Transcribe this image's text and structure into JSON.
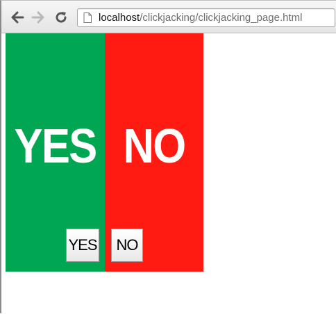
{
  "browser": {
    "url_host": "localhost",
    "url_path": "/clickjacking/clickjacking_page.html"
  },
  "colors": {
    "yes_panel": "#00a651",
    "no_panel": "#ff1a12"
  },
  "page": {
    "yes_panel_text": "YES",
    "no_panel_text": "NO",
    "yes_button_label": "YES",
    "no_button_label": "NO"
  }
}
